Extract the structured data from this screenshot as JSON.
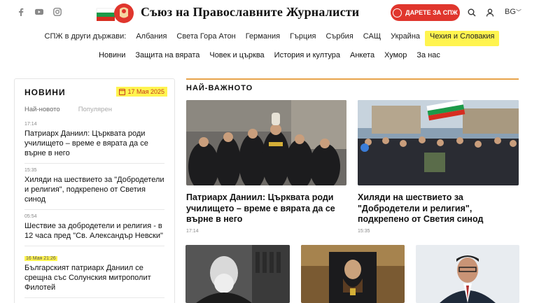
{
  "header": {
    "site_title": "Съюз на Православните Журналисти",
    "donate_label": "ДАРЕТЕ ЗА СПЖ",
    "lang": "BG",
    "social": [
      "facebook-icon",
      "youtube-icon",
      "instagram-icon"
    ]
  },
  "country_nav": {
    "label": "СПЖ в други държави:",
    "items": [
      "Албания",
      "Света Гора Атон",
      "Германия",
      "Гърция",
      "Сърбия",
      "САЩ",
      "Украйна",
      "Чехия и Словакия"
    ]
  },
  "main_nav": {
    "items": [
      "Новини",
      "Защита на вярата",
      "Човек и църква",
      "История и култура",
      "Анкета",
      "Хумор",
      "За нас"
    ]
  },
  "sidebar": {
    "title": "НОВИНИ",
    "date": "17 Мая 2025",
    "tabs": [
      "Най-новото",
      "Популярен"
    ],
    "items": [
      {
        "time": "17:14",
        "headline": "Патриарх Даниил: Църквата роди училището – време е вярата да се върне в него"
      },
      {
        "time": "15:35",
        "headline": "Хиляди на шествието за \"Добродетели и религия\", подкрепено от Светия синод"
      },
      {
        "time": "05:54",
        "headline": "Шествие за добродетели и религия - в 12 часа пред \"Св. Александър Невски\""
      },
      {
        "time": "16 Мая 21:26",
        "headline": "Българският патриарх Даниил се срещна със Солунския митрополит Филотей"
      }
    ]
  },
  "main": {
    "section_title": "НАЙ-ВАЖНОТО",
    "top_cards": [
      {
        "title": "Патриарх Даниил: Църквата роди училището – време е вярата да се върне в него",
        "time": "17:14"
      },
      {
        "title": "Хиляди на шествието за \"Добродетели и религия\", подкрепено от Светия синод",
        "time": "15:35"
      }
    ]
  },
  "colors": {
    "accent": "#e0362d",
    "highlight": "#fff44f",
    "section_line": "#e8a34a"
  }
}
